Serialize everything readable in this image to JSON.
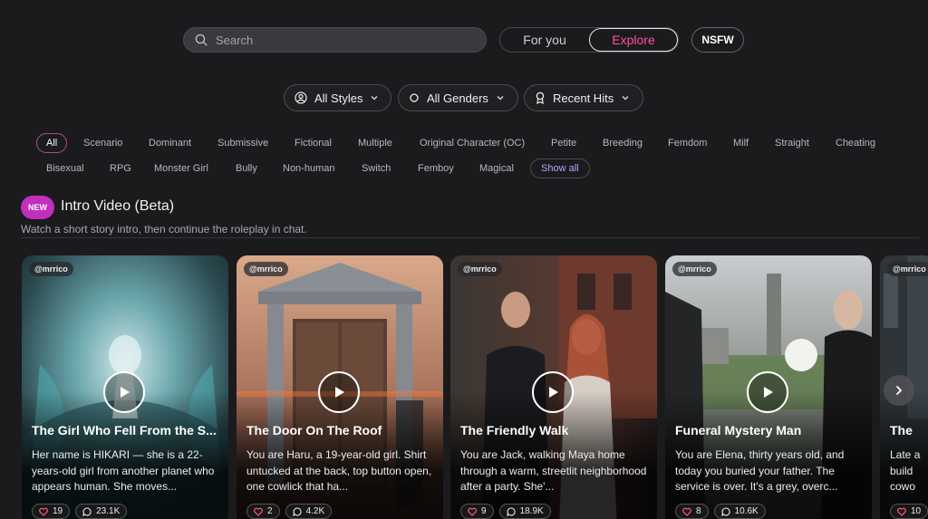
{
  "search": {
    "placeholder": "Search"
  },
  "feed_toggle": {
    "for_you": "For you",
    "explore": "Explore"
  },
  "nsfw_label": "NSFW",
  "filters": {
    "styles": "All Styles",
    "genders": "All Genders",
    "sort": "Recent Hits"
  },
  "tags": [
    "All",
    "Scenario",
    "Dominant",
    "Submissive",
    "Fictional",
    "Multiple",
    "Original Character (OC)",
    "Petite",
    "Breeding",
    "Femdom",
    "Milf",
    "Straight",
    "Cheating",
    "Bisexual",
    "RPG",
    "Monster Girl",
    "Bully",
    "Non-human",
    "Switch",
    "Femboy",
    "Magical"
  ],
  "show_all": "Show all",
  "section": {
    "badge": "NEW",
    "title": "Intro Video (Beta)",
    "description": "Watch a short story intro, then continue the roleplay in chat."
  },
  "cards": [
    {
      "author": "@mrrico",
      "title": "The Girl Who Fell From the S...",
      "description": "Her name is HIKARI — she is a 22-years-old girl from another planet who appears human. She moves...",
      "likes": "19",
      "comments": "23.1K"
    },
    {
      "author": "@mrrico",
      "title": "The Door On The Roof",
      "description": "You are Haru, a 19-year-old girl. Shirt untucked at the back, top button open, one cowlick that ha...",
      "likes": "2",
      "comments": "4.2K"
    },
    {
      "author": "@mrrico",
      "title": "The Friendly Walk",
      "description": "You are Jack, walking Maya home through a warm, streetlit neighborhood after a party. She'...",
      "likes": "9",
      "comments": "18.9K"
    },
    {
      "author": "@mrrico",
      "title": "Funeral Mystery Man",
      "description": "You are Elena, thirty years old, and today you buried your father. The service is over. It's a grey, overc...",
      "likes": "8",
      "comments": "10.6K"
    },
    {
      "author": "@mrrico",
      "title": "The",
      "description": "Late a build cowo",
      "likes": "10",
      "comments": ""
    }
  ],
  "colors": {
    "accent_pink": "#ff4fa3",
    "badge_magenta": "#c22ebd",
    "show_all_purple": "#b9a3ff",
    "background": "#1b1b1d"
  }
}
